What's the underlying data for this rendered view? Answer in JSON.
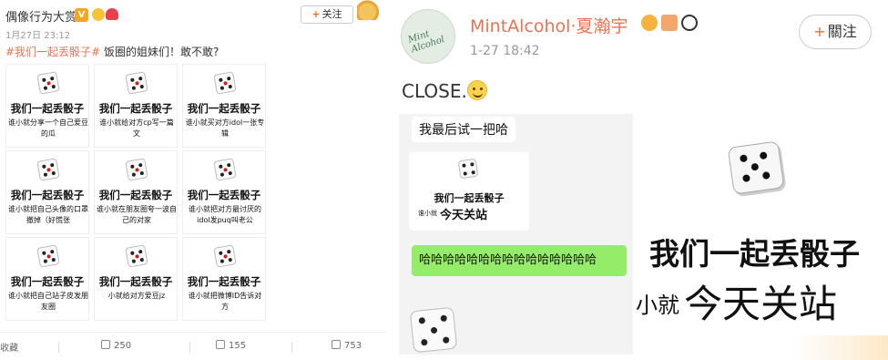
{
  "left_post": {
    "username": "偶像行为大赏",
    "verified_badge": "V",
    "timestamp": "1月27日 23:12",
    "follow_label": "关注",
    "follow_plus": "+",
    "hashtag": "#我们一起丢骰子#",
    "text": " 饭圈的姐妹们！敢不敢?",
    "grid": [
      {
        "title": "我们一起丢骰子",
        "sub": "谁小就分享一个自己爱豆的瓜"
      },
      {
        "title": "我们一起丢骰子",
        "sub": "谁小就给对方cp写一篇文"
      },
      {
        "title": "我们一起丢骰子",
        "sub": "谁小就买对方idol一张专辑"
      },
      {
        "title": "我们一起丢骰子",
        "sub": "谁小就把自己头像的口罩撤掉（好慌张"
      },
      {
        "title": "我们一起丢骰子",
        "sub": "谁小就在朋友圈夸一波自己的对家"
      },
      {
        "title": "我们一起丢骰子",
        "sub": "谁小就把对方最讨厌的idol发puq叫老公"
      },
      {
        "title": "我们一起丢骰子",
        "sub": "谁小就把自己站子皮发朋友圈"
      },
      {
        "title": "我们一起丢骰子",
        "sub": "小就给对方爱豆jz"
      },
      {
        "title": "我们一起丢骰子",
        "sub": "谁小就把微博ID告诉对方"
      }
    ],
    "actions": {
      "favorite_label": "收藏",
      "repost_count": "250",
      "comment_count": "155",
      "like_count": "753"
    }
  },
  "right_post": {
    "avatar_text": "Mint Alcohol",
    "username": "MintAlcohol·夏瀚宇",
    "timestamp": "1-27 18:42",
    "follow_label": "關注",
    "follow_plus": "+",
    "text": "CLOSE.",
    "chat": {
      "msg1": "我最后试一把哈",
      "card_title": "我们一起丢骰子",
      "card_prefix": "谁小就",
      "card_main": "今天关站",
      "reply": "哈哈哈哈哈哈哈哈哈哈哈哈哈哈哈"
    },
    "sticker": {
      "title": "我们一起丢骰子",
      "prefix": "小就",
      "main": "今天关站"
    }
  },
  "colors": {
    "accent": "#eb7350",
    "chat_bg": "#f3f3f3",
    "reply_bubble": "#95ec69"
  }
}
